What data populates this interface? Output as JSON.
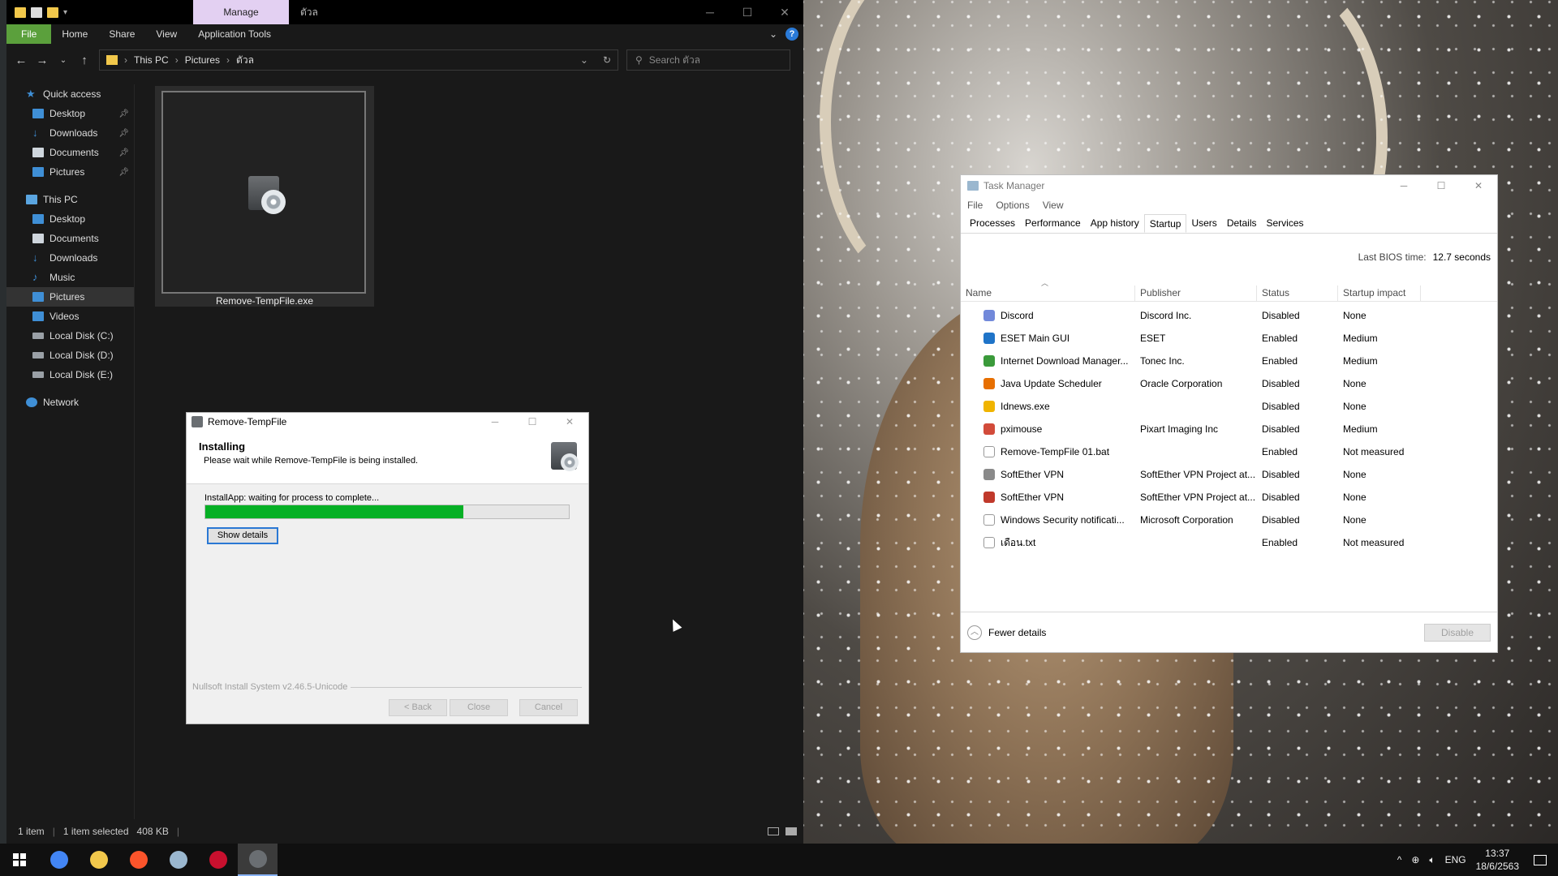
{
  "explorer": {
    "manage_tab": "Manage",
    "folder_title": "ตัวล",
    "ribbon_tabs": [
      "File",
      "Home",
      "Share",
      "View",
      "Application Tools"
    ],
    "breadcrumb": [
      "This PC",
      "Pictures",
      "ตัวล"
    ],
    "search_placeholder": "Search ตัวล",
    "nav_items": [
      {
        "label": "Quick access",
        "icon": "star-icon",
        "level": 1
      },
      {
        "label": "Desktop",
        "icon": "desktop-icon",
        "level": 2,
        "pinned": true
      },
      {
        "label": "Downloads",
        "icon": "download-icon",
        "level": 2,
        "pinned": true
      },
      {
        "label": "Documents",
        "icon": "documents-icon",
        "level": 2,
        "pinned": true
      },
      {
        "label": "Pictures",
        "icon": "pictures-icon",
        "level": 2,
        "pinned": true
      },
      {
        "label": "This PC",
        "icon": "this-pc-icon",
        "level": 1
      },
      {
        "label": "Desktop",
        "icon": "desktop-icon",
        "level": 2
      },
      {
        "label": "Documents",
        "icon": "documents-icon",
        "level": 2
      },
      {
        "label": "Downloads",
        "icon": "download-icon",
        "level": 2
      },
      {
        "label": "Music",
        "icon": "music-icon",
        "level": 2
      },
      {
        "label": "Pictures",
        "icon": "pictures-icon",
        "level": 2,
        "selected": true
      },
      {
        "label": "Videos",
        "icon": "videos-icon",
        "level": 2
      },
      {
        "label": "Local Disk (C:)",
        "icon": "drive-icon",
        "level": 2
      },
      {
        "label": "Local Disk (D:)",
        "icon": "drive-icon",
        "level": 2
      },
      {
        "label": "Local Disk (E:)",
        "icon": "drive-icon",
        "level": 2
      },
      {
        "label": "Network",
        "icon": "network-icon",
        "level": 1
      }
    ],
    "file": {
      "name": "Remove-TempFile.exe"
    },
    "status": {
      "count": "1 item",
      "selected": "1 item selected",
      "size": "408 KB"
    }
  },
  "installer": {
    "title": "Remove-TempFile",
    "heading": "Installing",
    "subheading": "Please wait while Remove-TempFile is being installed.",
    "progress_label": "InstallApp: waiting for process to complete...",
    "progress_fraction": 0.71,
    "show_details": "Show details",
    "branding": "Nullsoft Install System v2.46.5-Unicode",
    "buttons": {
      "back": "< Back",
      "close": "Close",
      "cancel": "Cancel"
    }
  },
  "task_manager": {
    "title": "Task Manager",
    "menu": [
      "File",
      "Options",
      "View"
    ],
    "tabs": [
      "Processes",
      "Performance",
      "App history",
      "Startup",
      "Users",
      "Details",
      "Services"
    ],
    "active_tab": "Startup",
    "bios_label": "Last BIOS time:",
    "bios_value": "12.7 seconds",
    "columns": [
      "Name",
      "Publisher",
      "Status",
      "Startup impact"
    ],
    "rows": [
      {
        "name": "Discord",
        "publisher": "Discord Inc.",
        "status": "Disabled",
        "impact": "None",
        "icon": "discord-icon",
        "color": "#7289da"
      },
      {
        "name": "ESET Main GUI",
        "publisher": "ESET",
        "status": "Enabled",
        "impact": "Medium",
        "icon": "eset-icon",
        "color": "#1f74c8"
      },
      {
        "name": "Internet Download Manager...",
        "publisher": "Tonec Inc.",
        "status": "Enabled",
        "impact": "Medium",
        "icon": "idm-icon",
        "color": "#3a9a3a"
      },
      {
        "name": "Java Update Scheduler",
        "publisher": "Oracle Corporation",
        "status": "Disabled",
        "impact": "None",
        "icon": "java-icon",
        "color": "#e76f00"
      },
      {
        "name": "Idnews.exe",
        "publisher": "",
        "status": "Disabled",
        "impact": "None",
        "icon": "idnews-icon",
        "color": "#f0b400"
      },
      {
        "name": "pximouse",
        "publisher": "Pixart Imaging Inc",
        "status": "Disabled",
        "impact": "Medium",
        "icon": "pximouse-icon",
        "color": "#d24b3a"
      },
      {
        "name": "Remove-TempFile 01.bat",
        "publisher": "",
        "status": "Enabled",
        "impact": "Not measured",
        "icon": "file-icon",
        "color": "#ffffff"
      },
      {
        "name": "SoftEther VPN",
        "publisher": "SoftEther VPN Project at...",
        "status": "Disabled",
        "impact": "None",
        "icon": "softether-icon",
        "color": "#8a8a8a"
      },
      {
        "name": "SoftEther VPN",
        "publisher": "SoftEther VPN Project at...",
        "status": "Disabled",
        "impact": "None",
        "icon": "softether-icon",
        "color": "#c0392b"
      },
      {
        "name": "Windows Security notificati...",
        "publisher": "Microsoft Corporation",
        "status": "Disabled",
        "impact": "None",
        "icon": "shield-icon",
        "color": "#ffffff"
      },
      {
        "name": "เดือน.txt",
        "publisher": "",
        "status": "Enabled",
        "impact": "Not measured",
        "icon": "file-icon",
        "color": "#ffffff"
      }
    ],
    "fewer_details": "Fewer details",
    "disable_button": "Disable"
  },
  "taskbar": {
    "apps": [
      {
        "icon": "chrome-icon",
        "color": "#4285f4"
      },
      {
        "icon": "file-explorer-icon",
        "color": "#f2c84b"
      },
      {
        "icon": "brave-icon",
        "color": "#fb542b"
      },
      {
        "icon": "task-manager-icon",
        "color": "#9ab7cf"
      },
      {
        "icon": "app-a-icon",
        "color": "#c8102e"
      },
      {
        "icon": "installer-icon",
        "color": "#6a6e72",
        "active": true
      }
    ],
    "language": "ENG",
    "time": "13:37",
    "date": "18/6/2563"
  }
}
